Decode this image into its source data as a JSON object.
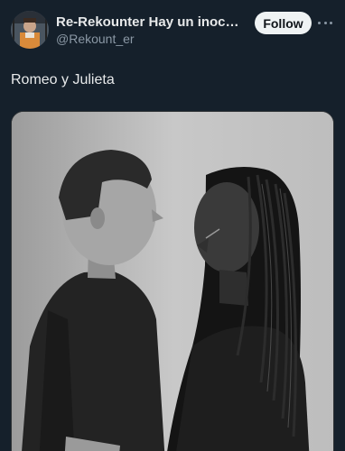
{
  "author": {
    "display_name": "Re-Rekounter Hay un inocen...",
    "handle": "@Rekount_er"
  },
  "follow_label": "Follow",
  "post": {
    "text": "Romeo y Julieta"
  },
  "icons": {
    "more": "more-horizontal-icon",
    "avatar": "avatar-image"
  },
  "colors": {
    "background": "#15202b",
    "text_primary": "#e7e9ea",
    "text_secondary": "#8b98a5",
    "follow_bg": "#eff3f4"
  }
}
